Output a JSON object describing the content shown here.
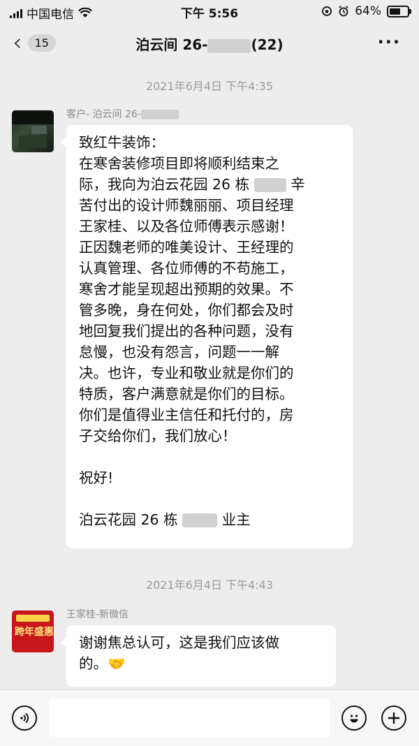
{
  "status_bar": {
    "carrier": "中国电信",
    "time": "下午 5:56",
    "battery": "64%",
    "battery_level": 0.64
  },
  "nav": {
    "back_count": "15",
    "title_prefix": "泊云间 26-",
    "title_suffix": "(22)"
  },
  "messages": [
    {
      "timestamp": "2021年6月4日 下午4:35",
      "sender": "客户- 泊云间 26-",
      "lines": [
        "致红牛装饰：",
        "在寒舍装修项目即将顺利结束之",
        "际，我向为泊云花园 26 栋",
        "辛",
        "苦付出的设计师魏丽丽、项目经理",
        "王家桂、以及各位师傅表示感谢！",
        "正因魏老师的唯美设计、王经理的",
        "认真管理、各位师傅的不苟施工，",
        "寒舍才能呈现超出预期的效果。不",
        "管多晚，身在何处，你们都会及时",
        "地回复我们提出的各种问题，没有",
        "怠慢，也没有怨言，问题一一解",
        "决。也许，专业和敬业就是你们的",
        "特质，客户满意就是你们的目标。",
        "你们是值得业主信任和托付的，房",
        "子交给你们，我们放心！",
        "祝好!",
        "泊云花园 26 栋",
        "业主"
      ]
    },
    {
      "timestamp": "2021年6月4日 下午4:43",
      "sender": "王家桂-新微信",
      "avatar_text": "跨年盛惠",
      "lines": [
        "谢谢焦总认可，这是我们应该做",
        "的。🤝"
      ]
    }
  ],
  "input_bar": {
    "voice_icon": "voice-icon",
    "emoji_icon": "emoji-icon",
    "plus_icon": "plus-icon"
  }
}
